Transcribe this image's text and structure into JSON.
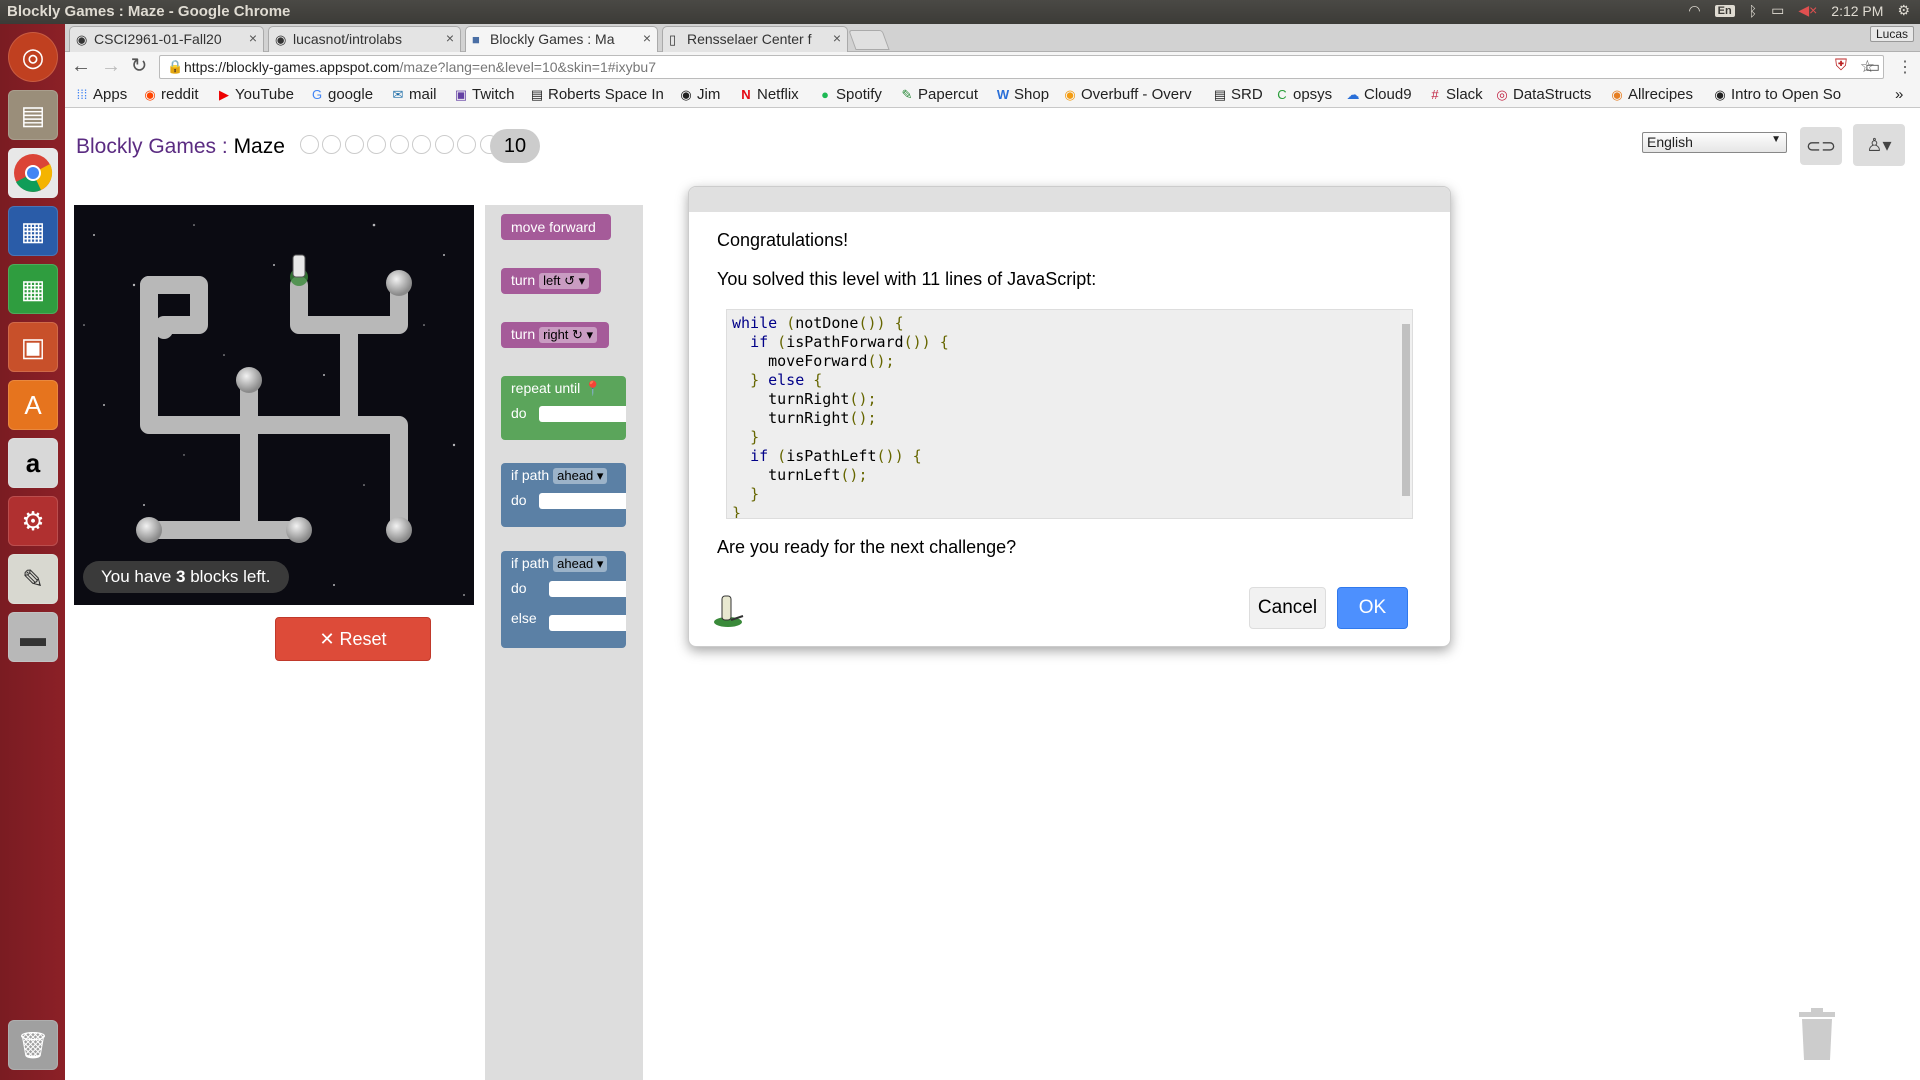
{
  "topbar": {
    "window_title": "Blockly Games : Maze - Google Chrome",
    "keyboard": "En",
    "time": "2:12 PM"
  },
  "tabs": [
    {
      "label": "CSCI2961-01-Fall20",
      "icon": "github-icon"
    },
    {
      "label": "lucasnot/introlabs",
      "icon": "github-icon"
    },
    {
      "label": "Blockly Games : Ma",
      "icon": "blockly-icon"
    },
    {
      "label": "Rensselaer Center f",
      "icon": "page-icon"
    }
  ],
  "profile_name": "Lucas",
  "url": "https://blockly-games.appspot.com/maze?lang=en&level=10&skin=1#ixybu7",
  "url_domain": "https://blockly-games.appspot.com",
  "url_path": "/maze?lang=en&level=10&skin=1#ixybu7",
  "bookmarks": [
    "Apps",
    "reddit",
    "YouTube",
    "google",
    "mail",
    "Twitch",
    "Roberts Space In",
    "Jim",
    "Netflix",
    "Spotify",
    "Papercut",
    "Shop",
    "Overbuff - Overv",
    "SRD",
    "opsys",
    "Cloud9",
    "Slack",
    "DataStructs",
    "Allrecipes",
    "Intro to Open So"
  ],
  "page": {
    "app_name": "Blockly Games",
    "separator": " : ",
    "game_name": "Maze",
    "level": "10",
    "language": "English",
    "capacity_prefix": "You have ",
    "capacity_count": "3",
    "capacity_suffix": " blocks left.",
    "reset_label": "Reset"
  },
  "blocks": {
    "move_forward": "move forward",
    "turn": "turn",
    "left": "left ↺",
    "right": "right ↻",
    "repeat_until": "repeat until",
    "do": "do",
    "if_path": "if path",
    "ahead": "ahead",
    "else": "else"
  },
  "dialog": {
    "heading": "Congratulations!",
    "message": "You solved this level with 11 lines of JavaScript:",
    "question": "Are you ready for the next challenge?",
    "cancel": "Cancel",
    "ok": "OK",
    "code_lines": [
      "while (notDone()) {",
      "  if (isPathForward()) {",
      "    moveForward();",
      "  } else {",
      "    turnRight();",
      "    turnRight();",
      "  }",
      "  if (isPathLeft()) {",
      "    turnLeft();",
      "  }",
      "}"
    ]
  },
  "colors": {
    "launcher": "#8c2027",
    "title_accent": "#5b2c82",
    "reset": "#dd4b39",
    "ok": "#4d90fe",
    "movement_block": "#a55b99",
    "loop_block": "#5ba55b",
    "logic_block": "#5b80a5"
  }
}
